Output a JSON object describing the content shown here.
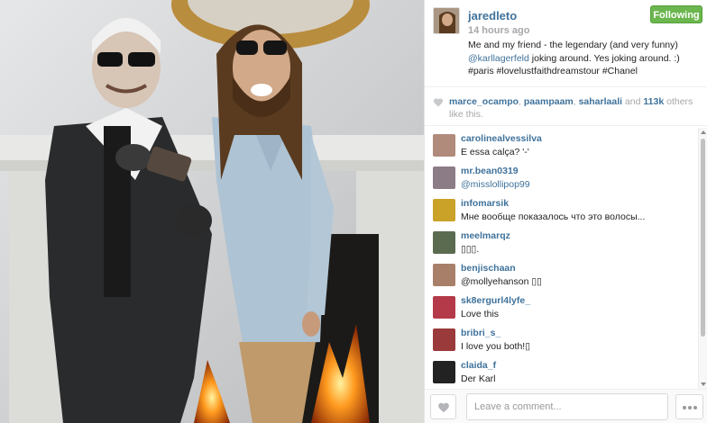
{
  "post": {
    "username": "jaredleto",
    "follow_label": "Following",
    "posted": "14 hours ago",
    "caption": {
      "line1": "Me and my friend - the legendary (and very funny)",
      "mention": "@karllagerfeld",
      "line2": " joking around. Yes joking around. :)",
      "tags": "#paris #lovelustfaithdreamstour #Chanel"
    }
  },
  "likes": {
    "users": [
      "marce_ocampo",
      "paampaam",
      "saharlaali"
    ],
    "sep1": ", ",
    "sep2": ", ",
    "and": " and ",
    "count": "113k",
    "suffix": " others like this."
  },
  "comments": [
    {
      "user": "carolinealvessilva",
      "text": "E essa calça? '-'",
      "mention": false,
      "color": "#b08a7a"
    },
    {
      "user": "mr.bean0319",
      "text": "@misslollipop99",
      "mention": true,
      "color": "#8c7c86"
    },
    {
      "user": "infomarsik",
      "text": "Мне вообще показалось что это волосы...",
      "mention": false,
      "color": "#c9a227"
    },
    {
      "user": "meelmarqz",
      "text": "▯▯▯.",
      "mention": false,
      "color": "#5b6b4f"
    },
    {
      "user": "benjischaan",
      "text": "@mollyehanson ▯▯",
      "mention": false,
      "color": "#a8806a"
    },
    {
      "user": "sk8ergurl4lyfe_",
      "text": "Love this",
      "mention": false,
      "color": "#b43a4a"
    },
    {
      "user": "bribri_s_",
      "text": "I love you both!▯",
      "mention": false,
      "color": "#9a3a3a"
    },
    {
      "user": "claida_f",
      "text": "Der Karl",
      "mention": false,
      "color": "#222222"
    }
  ],
  "footer": {
    "comment_placeholder": "Leave a comment..."
  },
  "colors": {
    "link": "#3f729b",
    "follow_green": "#6bb64e",
    "muted": "#a5a7aa"
  },
  "icons": {
    "like": "heart-icon",
    "more": "ellipsis-icon"
  }
}
